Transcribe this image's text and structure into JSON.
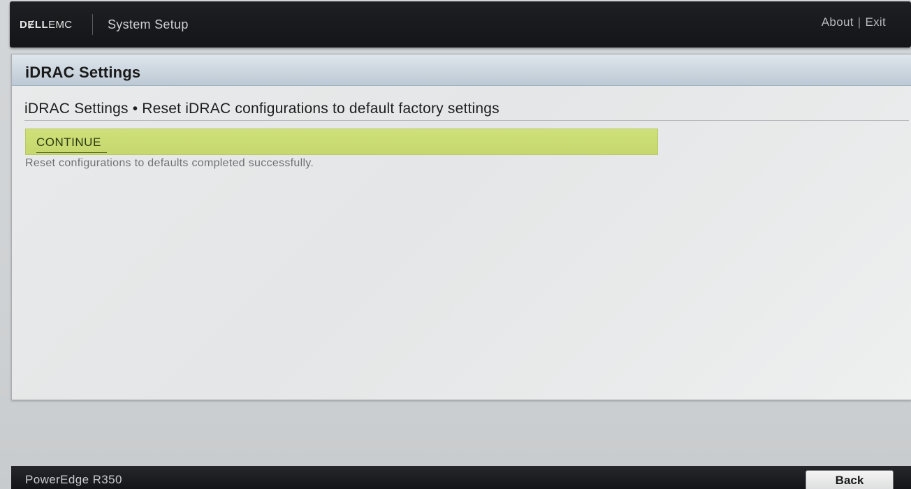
{
  "header": {
    "brand_dell": "DɆLL",
    "brand_emc": "EMC",
    "app_title": "System Setup",
    "about_label": "About",
    "separator": "|",
    "exit_label": "Exit"
  },
  "panel": {
    "title": "iDRAC Settings",
    "section_title": "iDRAC Settings • Reset iDRAC configurations to default factory settings",
    "continue_label": "CONTINUE",
    "status_message": "Reset configurations to defaults completed successfully."
  },
  "footer": {
    "model": "PowerEdge R350",
    "back_label": "Back"
  },
  "colors": {
    "header_bg": "#16171a",
    "panel_header_bg": "#c9d4dd",
    "highlight_row": "#cadb72",
    "status_text": "#6e7174"
  }
}
